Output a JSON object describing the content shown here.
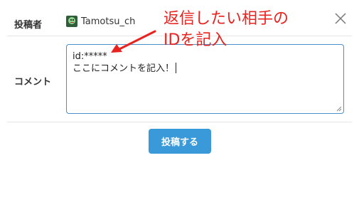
{
  "form": {
    "poster_label": "投稿者",
    "author_name": "Tamotsu_ch",
    "comment_label": "コメント",
    "comment_lines": [
      "id:*****",
      "ここにコメントを記入！"
    ],
    "submit_label": "投稿する"
  },
  "annotation": {
    "line1": "返信したい相手の",
    "line2": "IDを記入",
    "color": "#e8231f"
  },
  "colors": {
    "accent": "#3a9ad9",
    "input_border": "#4a90c8"
  }
}
